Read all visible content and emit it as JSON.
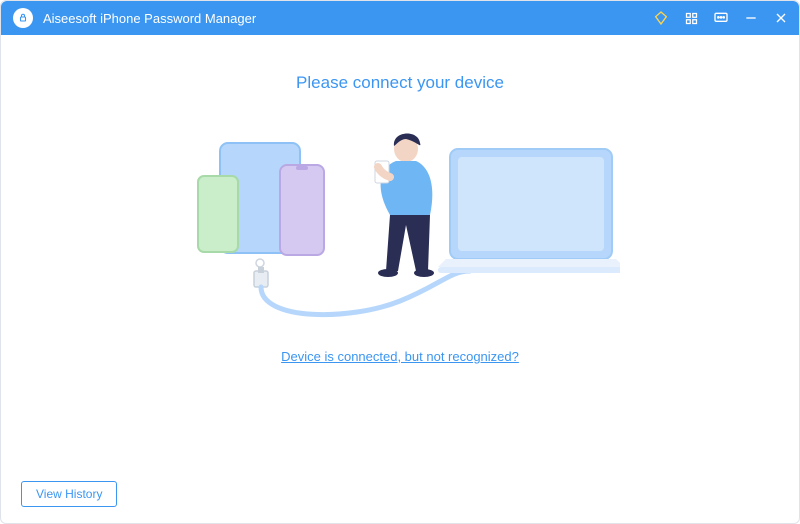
{
  "titlebar": {
    "app_name": "Aiseesoft iPhone Password Manager"
  },
  "main": {
    "heading": "Please connect your device",
    "help_link": "Device is connected, but not recognized?"
  },
  "footer": {
    "view_history_label": "View History"
  }
}
